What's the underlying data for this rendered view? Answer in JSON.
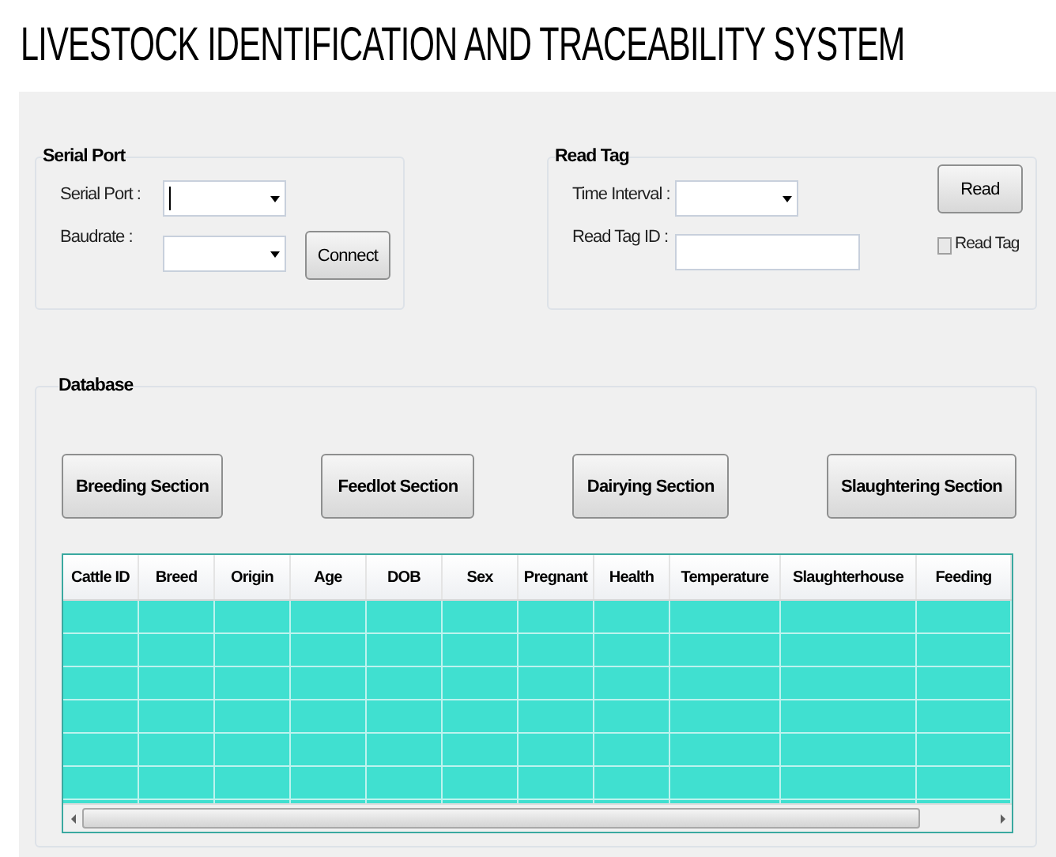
{
  "title": "LIVESTOCK IDENTIFICATION AND TRACEABILITY SYSTEM",
  "serial_port": {
    "title": "Serial Port",
    "fields": [
      {
        "label": "Serial Port :",
        "kind": "dropdown",
        "focused": true
      },
      {
        "label": "Baudrate :",
        "kind": "dropdown",
        "focused": false
      }
    ],
    "button": "Connect"
  },
  "read_tag": {
    "title": "Read Tag",
    "fields": [
      {
        "label": "Time Interval :",
        "kind": "dropdown",
        "focused": false
      },
      {
        "label": "Read Tag ID :",
        "kind": "text",
        "focused": false
      }
    ],
    "button": "Read",
    "checkbox": {
      "label": "Read Tag",
      "checked": false
    }
  },
  "database": {
    "title": "Database",
    "sections": [
      "Breeding Section",
      "Feedlot Section",
      "Dairying Section",
      "Slaughtering Section"
    ],
    "table": {
      "columns": [
        "Cattle ID",
        "Breed",
        "Origin",
        "Age",
        "DOB",
        "Sex",
        "Pregnant",
        "Health",
        "Temperature",
        "Slaughterhouse",
        "Feeding"
      ]
    }
  }
}
